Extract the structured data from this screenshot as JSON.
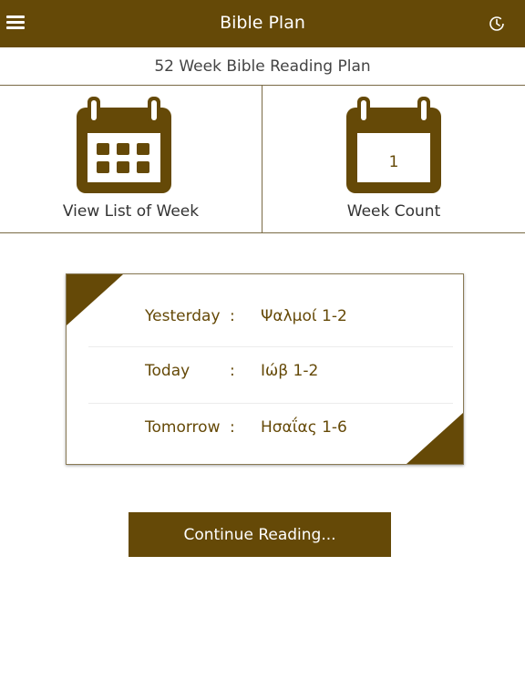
{
  "header": {
    "title": "Bible Plan",
    "menu_icon": "hamburger-menu-icon",
    "history_icon": "clock-history-icon"
  },
  "plan_title": "52 Week Bible Reading Plan",
  "tiles": {
    "week_list": {
      "label": "View List of Week",
      "icon": "calendar-grid-icon"
    },
    "week_count": {
      "label": "Week Count",
      "icon": "calendar-number-icon",
      "value": "1"
    }
  },
  "readings": [
    {
      "day": "Yesterday",
      "colon": ":",
      "passage": "Ψαλμοί 1-2"
    },
    {
      "day": "Today",
      "colon": ":",
      "passage": "Ιώβ 1-2"
    },
    {
      "day": "Tomorrow",
      "colon": ":",
      "passage": "Ησαΐας 1-6"
    }
  ],
  "continue_label": "Continue Reading...",
  "colors": {
    "brand": "#654907",
    "background": "#ffffff"
  }
}
